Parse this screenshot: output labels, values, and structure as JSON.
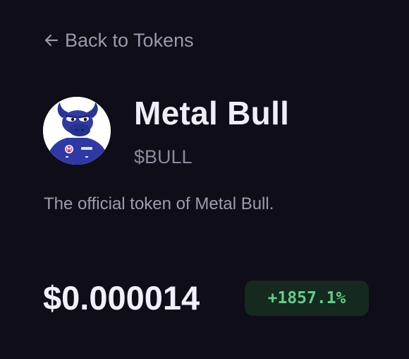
{
  "back_link": {
    "label": "Back to Tokens",
    "icon": "arrow-left-icon"
  },
  "token": {
    "name": "Metal Bull",
    "symbol": "$BULL",
    "description": "The official token of Metal Bull.",
    "avatar_icon": "bull-mascot-avatar",
    "price": "$0.000014",
    "change": "+1857.1%"
  },
  "colors": {
    "background": "#0e0d18",
    "text_primary": "#efeef5",
    "text_muted": "#9b99ab",
    "positive": "#5fcf8a",
    "positive_bg": "#16291f",
    "mascot_blue": "#2f3aa3"
  }
}
